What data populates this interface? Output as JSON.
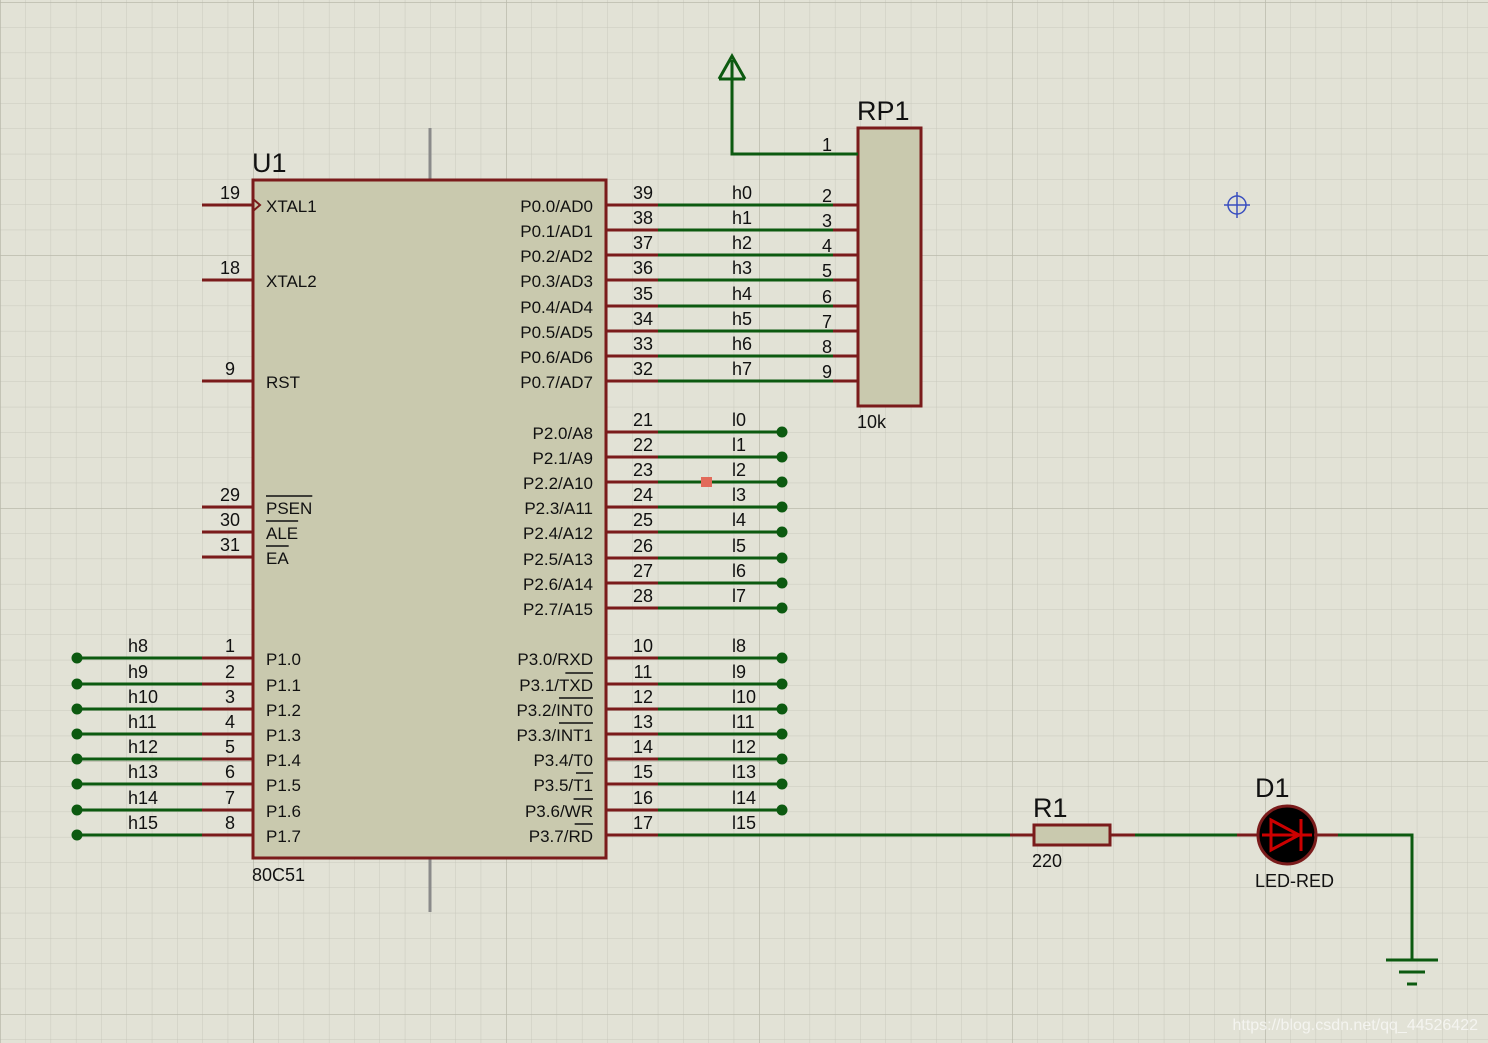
{
  "u1": {
    "ref": "U1",
    "part": "80C51",
    "left_pins": [
      {
        "num": "19",
        "name": "XTAL1",
        "clock": true
      },
      {
        "num": "18",
        "name": "XTAL2"
      },
      {
        "num": "9",
        "name": "RST"
      },
      {
        "num": "29",
        "name": "PSEN",
        "overbar": true
      },
      {
        "num": "30",
        "name": "ALE",
        "overbar": true
      },
      {
        "num": "31",
        "name": "EA",
        "overbar": true
      },
      {
        "num": "1",
        "name": "P1.0",
        "net": "h8"
      },
      {
        "num": "2",
        "name": "P1.1",
        "net": "h9"
      },
      {
        "num": "3",
        "name": "P1.2",
        "net": "h10"
      },
      {
        "num": "4",
        "name": "P1.3",
        "net": "h11"
      },
      {
        "num": "5",
        "name": "P1.4",
        "net": "h12"
      },
      {
        "num": "6",
        "name": "P1.5",
        "net": "h13"
      },
      {
        "num": "7",
        "name": "P1.6",
        "net": "h14"
      },
      {
        "num": "8",
        "name": "P1.7",
        "net": "h15"
      }
    ],
    "right_pins": [
      {
        "num": "39",
        "name": "P0.0/AD0",
        "net": "h0"
      },
      {
        "num": "38",
        "name": "P0.1/AD1",
        "net": "h1"
      },
      {
        "num": "37",
        "name": "P0.2/AD2",
        "net": "h2"
      },
      {
        "num": "36",
        "name": "P0.3/AD3",
        "net": "h3"
      },
      {
        "num": "35",
        "name": "P0.4/AD4",
        "net": "h4"
      },
      {
        "num": "34",
        "name": "P0.5/AD5",
        "net": "h5"
      },
      {
        "num": "33",
        "name": "P0.6/AD6",
        "net": "h6"
      },
      {
        "num": "32",
        "name": "P0.7/AD7",
        "net": "h7"
      },
      {
        "num": "21",
        "name": "P2.0/A8",
        "net": "l0"
      },
      {
        "num": "22",
        "name": "P2.1/A9",
        "net": "l1"
      },
      {
        "num": "23",
        "name": "P2.2/A10",
        "net": "l2"
      },
      {
        "num": "24",
        "name": "P2.3/A11",
        "net": "l3"
      },
      {
        "num": "25",
        "name": "P2.4/A12",
        "net": "l4"
      },
      {
        "num": "26",
        "name": "P2.5/A13",
        "net": "l5"
      },
      {
        "num": "27",
        "name": "P2.6/A14",
        "net": "l6"
      },
      {
        "num": "28",
        "name": "P2.7/A15",
        "net": "l7"
      },
      {
        "num": "10",
        "name": "P3.0/RXD",
        "net": "l8"
      },
      {
        "num": "11",
        "name": "P3.1/TXD",
        "net": "l9",
        "bar": "TXD"
      },
      {
        "num": "12",
        "name": "P3.2/INT0",
        "net": "l10",
        "bar": "INT0"
      },
      {
        "num": "13",
        "name": "P3.3/INT1",
        "net": "l11",
        "bar": "INT1"
      },
      {
        "num": "14",
        "name": "P3.4/T0",
        "net": "l12"
      },
      {
        "num": "15",
        "name": "P3.5/T1",
        "net": "l13",
        "bar": "T1"
      },
      {
        "num": "16",
        "name": "P3.6/WR",
        "net": "l14",
        "bar": "WR"
      },
      {
        "num": "17",
        "name": "P3.7/RD",
        "net": "l15",
        "bar": "RD"
      }
    ]
  },
  "rp1": {
    "ref": "RP1",
    "value": "10k",
    "pins": [
      "1",
      "2",
      "3",
      "4",
      "5",
      "6",
      "7",
      "8",
      "9"
    ]
  },
  "r1": {
    "ref": "R1",
    "value": "220"
  },
  "d1": {
    "ref": "D1",
    "value": "LED-RED"
  },
  "watermark": "https://blog.csdn.net/qq_44526422",
  "colors": {
    "background": "#e2e2d6",
    "pin": "#7a1b1b",
    "wire": "#0c5a10",
    "body": "#c9c9ae",
    "led": "#cc0000"
  }
}
